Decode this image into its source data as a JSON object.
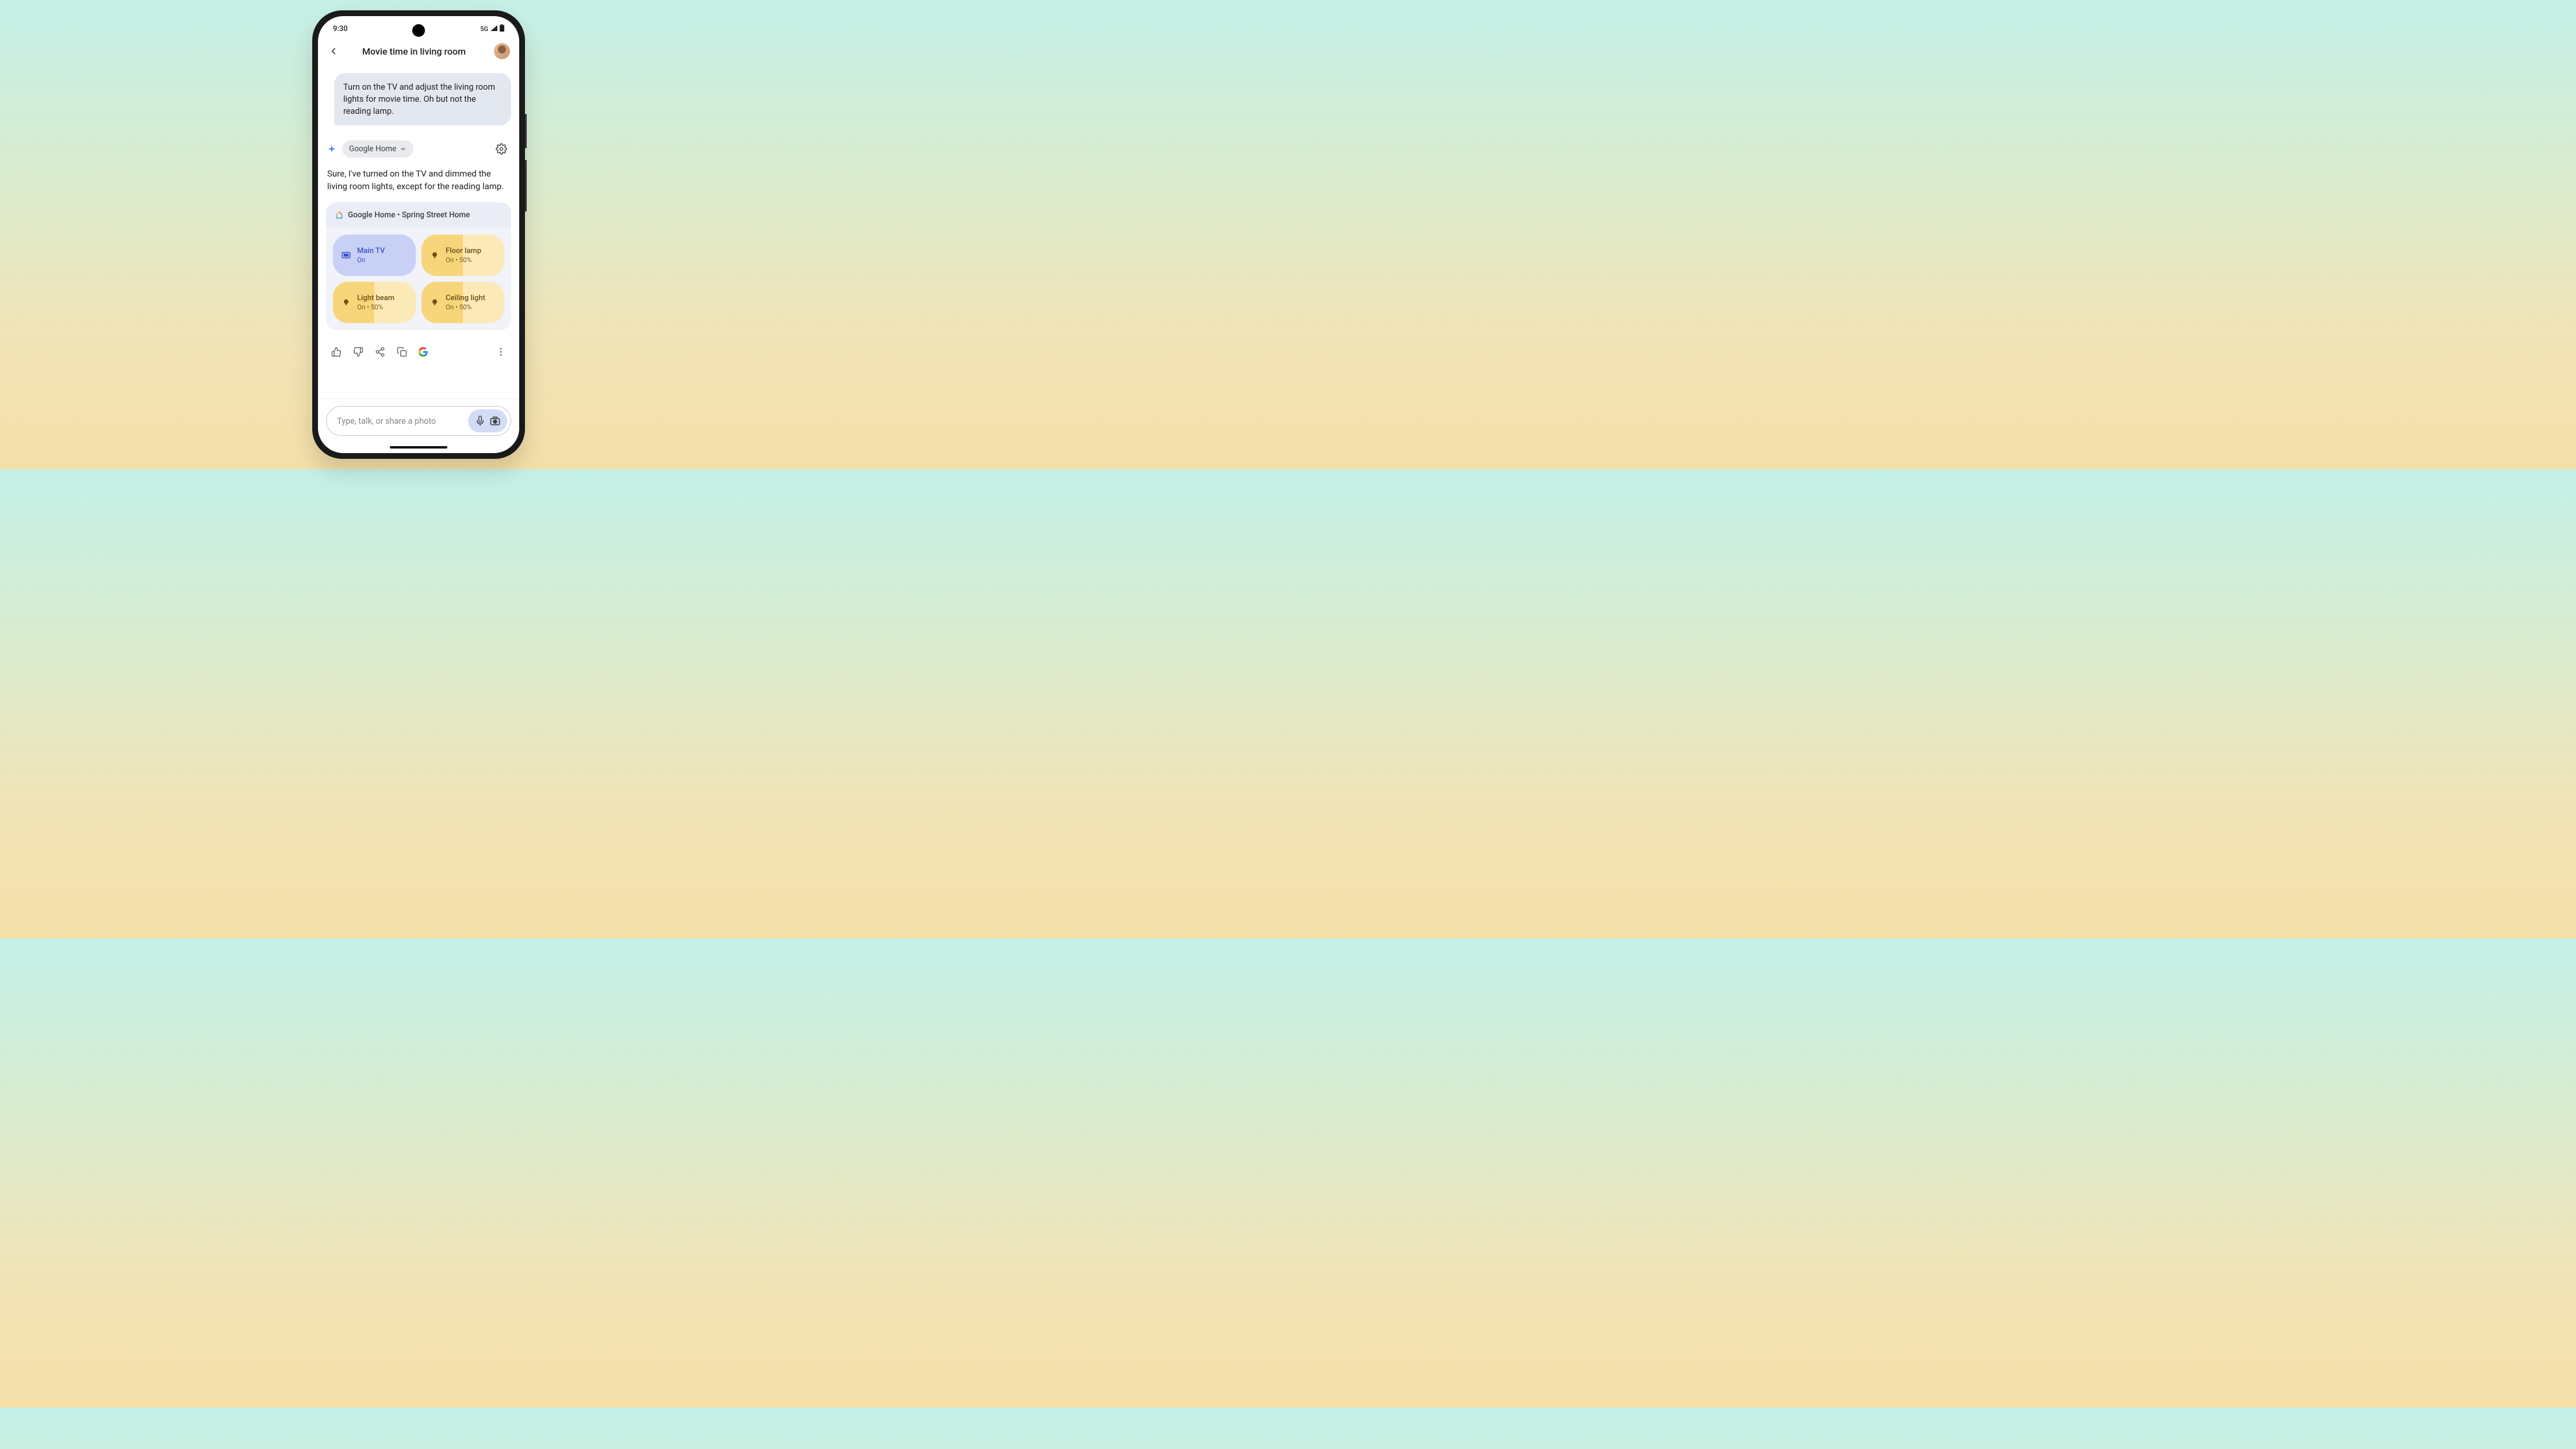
{
  "status": {
    "time": "9:30",
    "network": "5G"
  },
  "header": {
    "title": "Movie time in living room"
  },
  "user_message": "Turn on the TV and adjust the living room lights for movie time. Oh but not the reading lamp.",
  "extension": {
    "label": "Google Home"
  },
  "assistant_message": "Sure, I've turned on the TV and dimmed the living room lights, except for the reading lamp.",
  "card": {
    "header": "Google Home • Spring Street Home",
    "devices": [
      {
        "name": "Main TV",
        "status": "On",
        "type": "tv"
      },
      {
        "name": "Floor lamp",
        "status": "On • 50%",
        "type": "light"
      },
      {
        "name": "Light beam",
        "status": "On • 50%",
        "type": "light"
      },
      {
        "name": "Ceiling light",
        "status": "On • 50%",
        "type": "light"
      }
    ]
  },
  "input": {
    "placeholder": "Type, talk, or share a photo"
  }
}
